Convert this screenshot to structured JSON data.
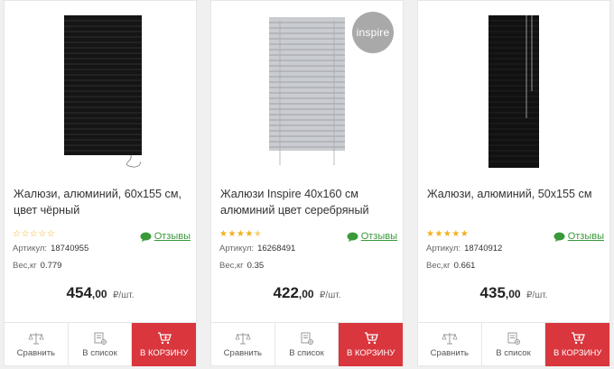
{
  "products": [
    {
      "title": "Жалюзи, алюминий, 60x155 см, цвет чёрный",
      "rating": 0,
      "reviews_label": "Отзывы",
      "article_label": "Артикул:",
      "article": "18740955",
      "weight_label": "Вес,кг",
      "weight": "0.779",
      "price_int": "454",
      "price_dec": ",00",
      "price_unit": "₽/шт.",
      "compare_label": "Сравнить",
      "list_label": "В список",
      "cart_label": "В КОРЗИНУ",
      "image": "black-blinds"
    },
    {
      "title": "Жалюзи Inspire 40x160 см алюминий цвет серебряный",
      "rating": 4.5,
      "badge": "inspire",
      "reviews_label": "Отзывы",
      "article_label": "Артикул:",
      "article": "16268491",
      "weight_label": "Вес,кг",
      "weight": "0.35",
      "price_int": "422",
      "price_dec": ",00",
      "price_unit": "₽/шт.",
      "compare_label": "Сравнить",
      "list_label": "В список",
      "cart_label": "В КОРЗИНУ",
      "image": "silver-blinds"
    },
    {
      "title": "Жалюзи, алюминий, 50x155 см",
      "rating": 5,
      "reviews_label": "Отзывы",
      "article_label": "Артикул:",
      "article": "18740912",
      "weight_label": "Вес,кг",
      "weight": "0.661",
      "price_int": "435",
      "price_dec": ",00",
      "price_unit": "₽/шт.",
      "compare_label": "Сравнить",
      "list_label": "В список",
      "cart_label": "В КОРЗИНУ",
      "image": "black-blinds-narrow"
    }
  ],
  "colors": {
    "accent_red": "#d9363e",
    "review_green": "#3a9a3a",
    "star": "#f2b01e"
  }
}
